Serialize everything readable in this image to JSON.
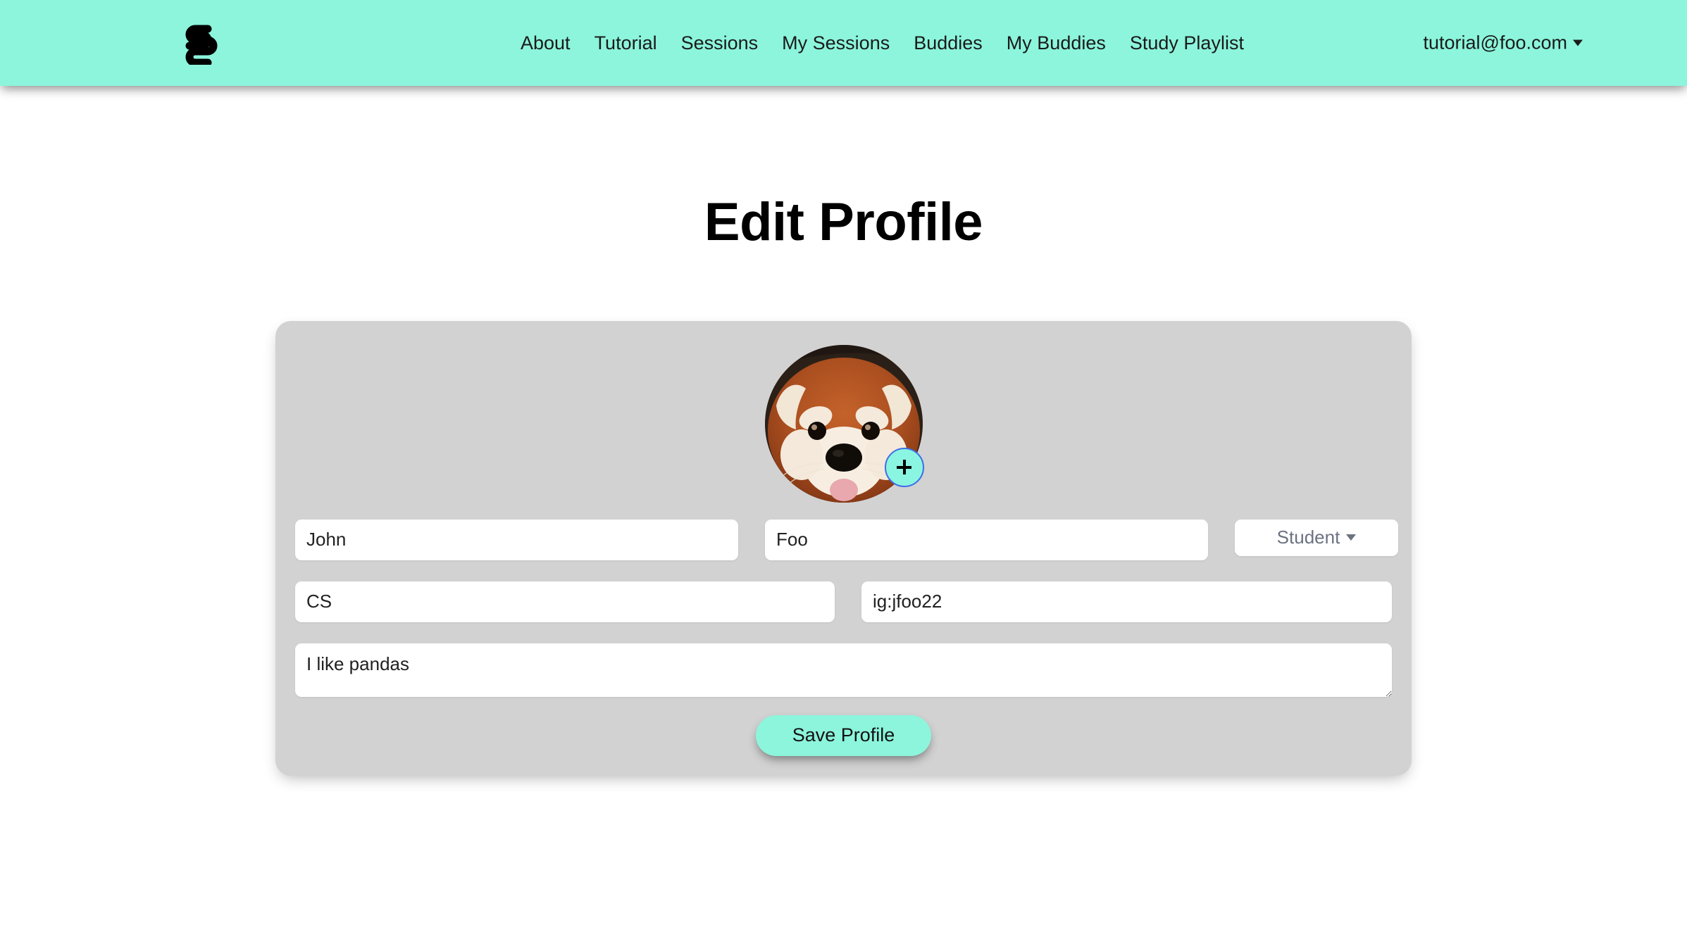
{
  "navbar": {
    "brand_icon": "logo-icon",
    "links": [
      {
        "label": "About"
      },
      {
        "label": "Tutorial"
      },
      {
        "label": "Sessions"
      },
      {
        "label": "My Sessions"
      },
      {
        "label": "Buddies"
      },
      {
        "label": "My Buddies"
      },
      {
        "label": "Study Playlist"
      }
    ],
    "user": {
      "email": "tutorial@foo.com",
      "caret_icon": "chevron-down-icon"
    },
    "background_color": "#8cf5dc"
  },
  "page": {
    "title": "Edit Profile",
    "background_color": "#ffffff"
  },
  "card": {
    "background_color": "#d2d2d2",
    "avatar": {
      "alt": "red-panda-avatar",
      "add_photo_icon": "plus-icon"
    },
    "form": {
      "first_name": {
        "value": "John",
        "placeholder": "First Name"
      },
      "last_name": {
        "value": "Foo",
        "placeholder": "Last Name"
      },
      "role": {
        "value": "Student",
        "caret_icon": "chevron-down-icon"
      },
      "major": {
        "value": "CS",
        "placeholder": "Major"
      },
      "social": {
        "value": "ig:jfoo22",
        "placeholder": "Social"
      },
      "bio": {
        "value": "I like pandas",
        "placeholder": "Bio"
      }
    },
    "save_button": {
      "label": "Save Profile",
      "background_color": "#8cf5dc"
    }
  }
}
